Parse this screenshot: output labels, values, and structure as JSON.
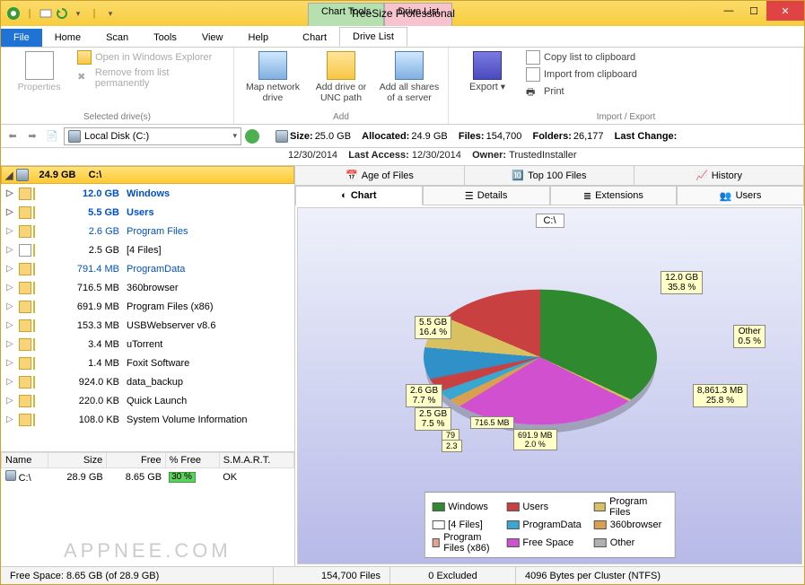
{
  "window": {
    "title": "TreeSize Professional"
  },
  "context_tabs": {
    "chart": "Chart Tools",
    "drive": "Drive List"
  },
  "ribbon_tabs": [
    "File",
    "Home",
    "Scan",
    "Tools",
    "View",
    "Help",
    "Chart",
    "Drive List"
  ],
  "ribbon": {
    "group1": {
      "label": "Selected drive(s)",
      "properties": "Properties",
      "open_explorer": "Open in Windows Explorer",
      "remove": "Remove from list permanently"
    },
    "group2": {
      "label": "Add",
      "map": "Map network\ndrive",
      "add_drive": "Add drive or\nUNC path",
      "add_shares": "Add all shares\nof a server"
    },
    "group3": {
      "label": "Import / Export",
      "export": "Export",
      "copy": "Copy list to clipboard",
      "import": "Import from clipboard",
      "print": "Print"
    }
  },
  "address": "Local Disk (C:)",
  "stats": {
    "size_l": "Size:",
    "size_v": "25.0 GB",
    "alloc_l": "Allocated:",
    "alloc_v": "24.9 GB",
    "files_l": "Files:",
    "files_v": "154,700",
    "folders_l": "Folders:",
    "folders_v": "26,177",
    "lastchange_l": "Last Change:",
    "lastchange_v": "12/30/2014",
    "lastaccess_l": "Last Access:",
    "lastaccess_v": "12/30/2014",
    "owner_l": "Owner:",
    "owner_v": "TrustedInstaller"
  },
  "tree_root": {
    "size": "24.9 GB",
    "name": "C:\\"
  },
  "tree": [
    {
      "bar": 100,
      "size": "12.0 GB",
      "name": "Windows",
      "sel": true
    },
    {
      "bar": 46,
      "size": "5.5 GB",
      "name": "Users",
      "sel": true
    },
    {
      "bar": 22,
      "size": "2.6 GB",
      "name": "Program Files",
      "link": true
    },
    {
      "bar": 21,
      "size": "2.5 GB",
      "name": "[4 Files]",
      "file": true
    },
    {
      "bar": 7,
      "size": "791.4 MB",
      "name": "ProgramData",
      "link": true
    },
    {
      "bar": 6,
      "size": "716.5 MB",
      "name": "360browser"
    },
    {
      "bar": 6,
      "size": "691.9 MB",
      "name": "Program Files (x86)"
    },
    {
      "bar": 2,
      "size": "153.3 MB",
      "name": "USBWebserver v8.6"
    },
    {
      "bar": 1,
      "size": "3.4 MB",
      "name": "uTorrent"
    },
    {
      "bar": 1,
      "size": "1.4 MB",
      "name": "Foxit Software"
    },
    {
      "bar": 1,
      "size": "924.0 KB",
      "name": "data_backup"
    },
    {
      "bar": 1,
      "size": "220.0 KB",
      "name": "Quick Launch"
    },
    {
      "bar": 1,
      "size": "108.0 KB",
      "name": "System Volume Information"
    }
  ],
  "drive_cols": [
    "Name",
    "Size",
    "Free",
    "% Free",
    "S.M.A.R.T."
  ],
  "drive_row": {
    "name": "C:\\",
    "size": "28.9 GB",
    "free": "8.65 GB",
    "pct": "30 %",
    "smart": "OK"
  },
  "top_tabs": [
    "Age of Files",
    "Top 100 Files",
    "History"
  ],
  "sub_tabs": [
    "Chart",
    "Details",
    "Extensions",
    "Users"
  ],
  "chart_title": "C:\\",
  "callouts": {
    "c1": "12.0 GB\n35.8 %",
    "c2": "Other\n0.5 %",
    "c3": "8,861.3 MB\n25.8 %",
    "c4": "691.9 MB\n2.0 %",
    "c5": "716.5 MB",
    "c6": "79",
    "c6b": "2.3",
    "c7": "2.5 GB\n7.5 %",
    "c8": "2.6 GB\n7.7 %",
    "c9": "5.5 GB\n16.4 %"
  },
  "legend": [
    {
      "c": "#2f8a2f",
      "t": "Windows"
    },
    {
      "c": "#c84040",
      "t": "Users"
    },
    {
      "c": "#d9c060",
      "t": "Program Files"
    },
    {
      "c": "#ffffff",
      "t": "[4 Files]"
    },
    {
      "c": "#3aa7d0",
      "t": "ProgramData"
    },
    {
      "c": "#d9a050",
      "t": "360browser"
    },
    {
      "c": "#e8a090",
      "t": "Program Files (x86)"
    },
    {
      "c": "#d050d0",
      "t": "Free Space"
    },
    {
      "c": "#b0b0b0",
      "t": "Other"
    }
  ],
  "status": {
    "free": "Free Space: 8.65 GB  (of 28.9 GB)",
    "files": "154,700  Files",
    "excluded": "0 Excluded",
    "cluster": "4096 Bytes per Cluster (NTFS)"
  },
  "watermark": "APPNEE.COM",
  "chart_data": {
    "type": "pie",
    "title": "C:\\",
    "series": [
      {
        "name": "Windows",
        "value_gb": 12.0,
        "percent": 35.8,
        "color": "#2f8a2f"
      },
      {
        "name": "Users",
        "value_gb": 5.5,
        "percent": 16.4,
        "color": "#c84040"
      },
      {
        "name": "Program Files",
        "value_gb": 2.6,
        "percent": 7.7,
        "color": "#d9c060"
      },
      {
        "name": "[4 Files]",
        "value_gb": 2.5,
        "percent": 7.5,
        "color": "#ffffff"
      },
      {
        "name": "ProgramData",
        "value_mb": 791.4,
        "percent": 2.3,
        "color": "#3aa7d0"
      },
      {
        "name": "360browser",
        "value_mb": 716.5,
        "percent": 2.1,
        "color": "#d9a050"
      },
      {
        "name": "Program Files (x86)",
        "value_mb": 691.9,
        "percent": 2.0,
        "color": "#e8a090"
      },
      {
        "name": "Free Space",
        "value_mb": 8861.3,
        "percent": 25.8,
        "color": "#d050d0"
      },
      {
        "name": "Other",
        "percent": 0.5,
        "color": "#b0b0b0"
      }
    ]
  }
}
